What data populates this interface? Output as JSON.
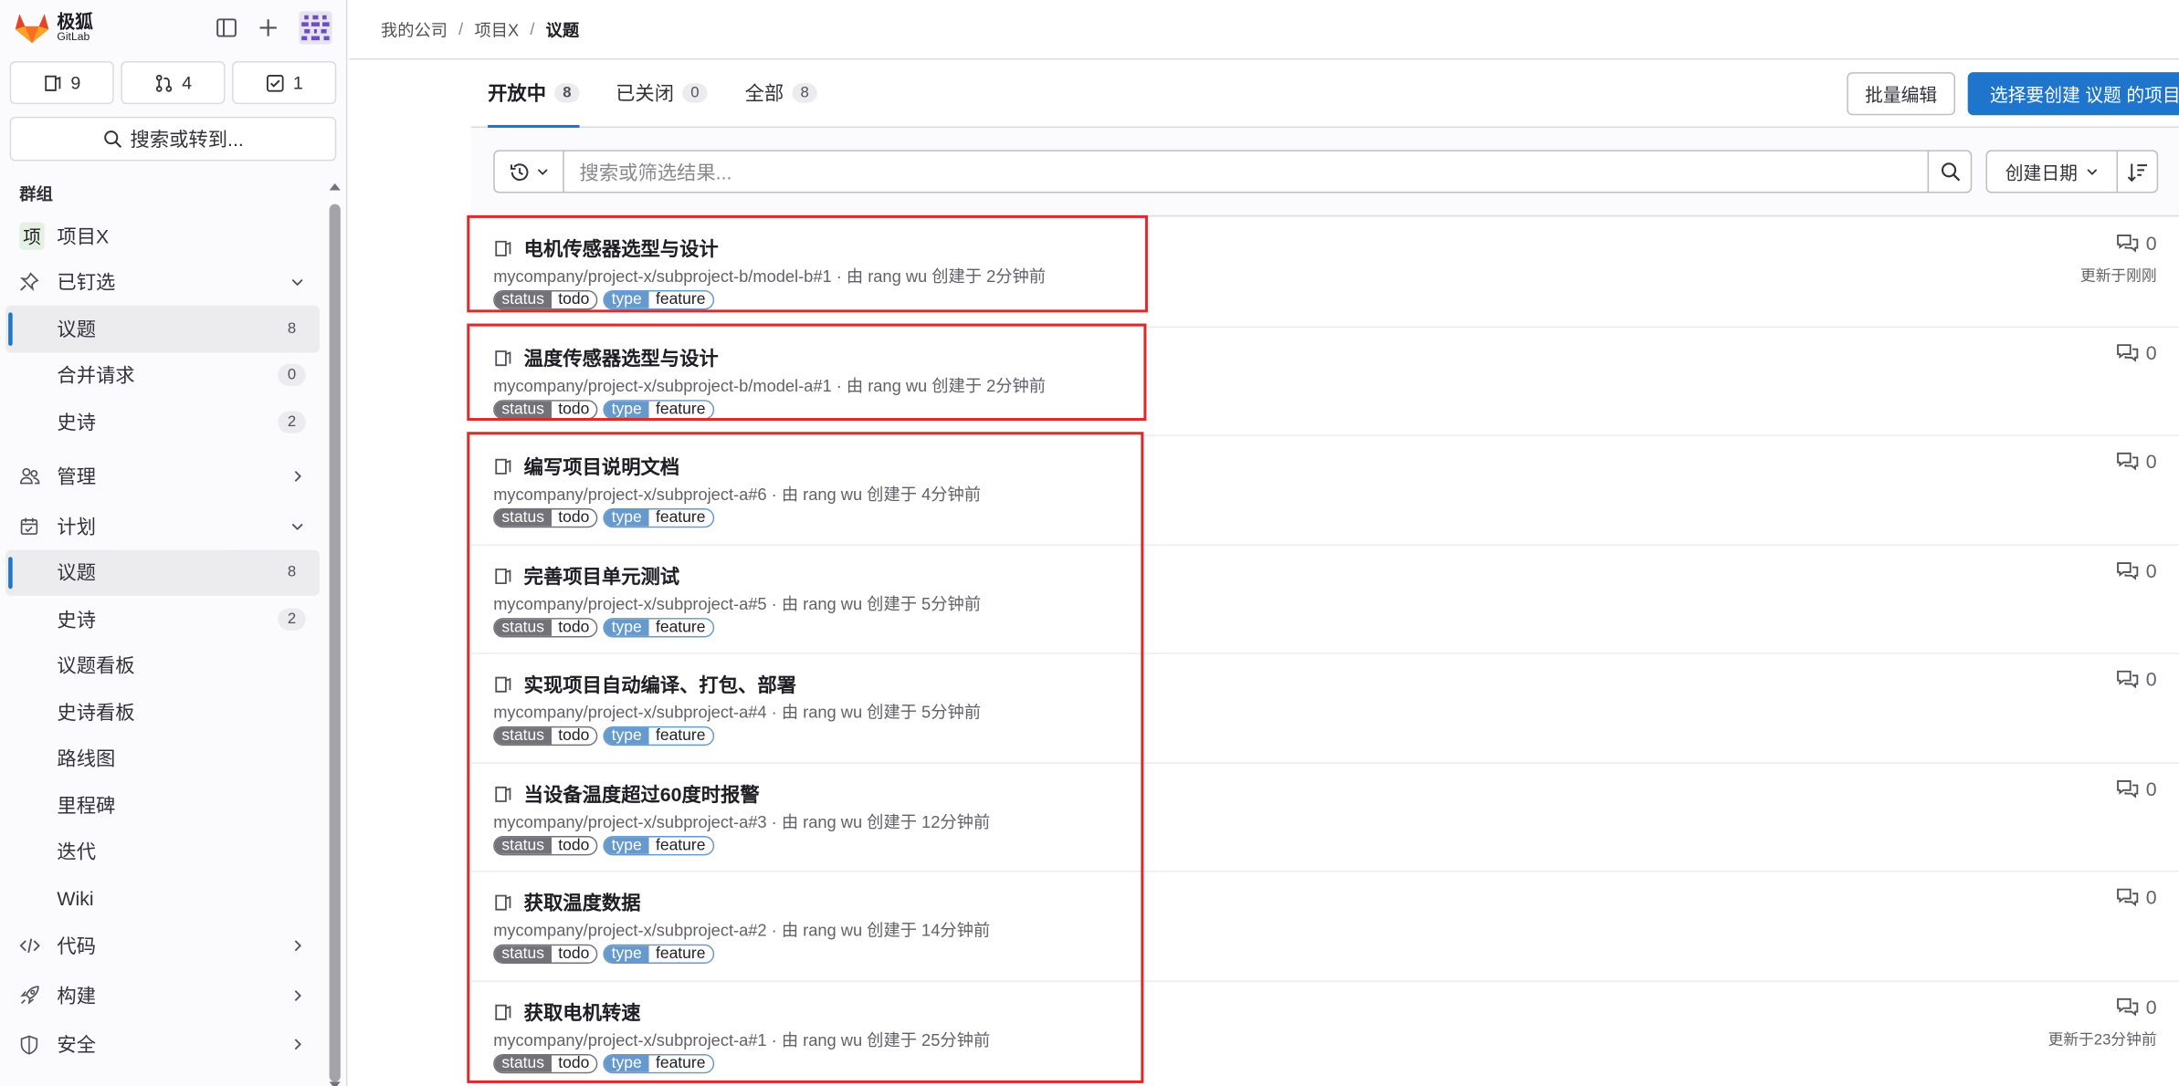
{
  "brand": {
    "name": "极狐",
    "sub": "GitLab"
  },
  "counters": {
    "issues": "9",
    "merge_requests": "4",
    "todos": "1"
  },
  "search": {
    "label": "搜索或转到..."
  },
  "sidebar": {
    "group_label": "群组",
    "project": {
      "badge": "项",
      "name": "项目X"
    },
    "pinned": {
      "label": "已钉选",
      "items": [
        {
          "label": "议题",
          "count": "8"
        },
        {
          "label": "合并请求",
          "count": "0"
        },
        {
          "label": "史诗",
          "count": "2"
        }
      ]
    },
    "manage": {
      "label": "管理"
    },
    "plan": {
      "label": "计划",
      "items": [
        {
          "label": "议题",
          "count": "8"
        },
        {
          "label": "史诗",
          "count": "2"
        },
        {
          "label": "议题看板"
        },
        {
          "label": "史诗看板"
        },
        {
          "label": "路线图"
        },
        {
          "label": "里程碑"
        },
        {
          "label": "迭代"
        },
        {
          "label": "Wiki"
        }
      ]
    },
    "code": {
      "label": "代码"
    },
    "build": {
      "label": "构建"
    },
    "security": {
      "label": "安全"
    }
  },
  "breadcrumb": [
    "我的公司",
    "项目X",
    "议题"
  ],
  "tabs": [
    {
      "label": "开放中",
      "count": "8"
    },
    {
      "label": "已关闭",
      "count": "0"
    },
    {
      "label": "全部",
      "count": "8"
    }
  ],
  "actions": {
    "bulk_edit": "批量编辑",
    "create": "选择要创建 议题 的项目"
  },
  "filter": {
    "placeholder": "搜索或筛选结果...",
    "sort": "创建日期"
  },
  "colors": {
    "accent": "#1f75cb",
    "status_label": "#737278",
    "type_label": "#6699cc",
    "highlight": "#dd2b2b"
  },
  "issues": [
    {
      "title": "电机传感器选型与设计",
      "meta": "mycompany/project-x/subproject-b/model-b#1 · 由 rang wu 创建于 2分钟前",
      "status": "todo",
      "type": "feature",
      "comments": "0",
      "updated": "更新于刚刚"
    },
    {
      "title": "温度传感器选型与设计",
      "meta": "mycompany/project-x/subproject-b/model-a#1 · 由 rang wu 创建于 2分钟前",
      "status": "todo",
      "type": "feature",
      "comments": "0",
      "updated": ""
    },
    {
      "title": "编写项目说明文档",
      "meta": "mycompany/project-x/subproject-a#6 · 由 rang wu 创建于 4分钟前",
      "status": "todo",
      "type": "feature",
      "comments": "0",
      "updated": ""
    },
    {
      "title": "完善项目单元测试",
      "meta": "mycompany/project-x/subproject-a#5 · 由 rang wu 创建于 5分钟前",
      "status": "todo",
      "type": "feature",
      "comments": "0",
      "updated": ""
    },
    {
      "title": "实现项目自动编译、打包、部署",
      "meta": "mycompany/project-x/subproject-a#4 · 由 rang wu 创建于 5分钟前",
      "status": "todo",
      "type": "feature",
      "comments": "0",
      "updated": ""
    },
    {
      "title": "当设备温度超过60度时报警",
      "meta": "mycompany/project-x/subproject-a#3 · 由 rang wu 创建于 12分钟前",
      "status": "todo",
      "type": "feature",
      "comments": "0",
      "updated": ""
    },
    {
      "title": "获取温度数据",
      "meta": "mycompany/project-x/subproject-a#2 · 由 rang wu 创建于 14分钟前",
      "status": "todo",
      "type": "feature",
      "comments": "0",
      "updated": ""
    },
    {
      "title": "获取电机转速",
      "meta": "mycompany/project-x/subproject-a#1 · 由 rang wu 创建于 25分钟前",
      "status": "todo",
      "type": "feature",
      "comments": "0",
      "updated": "更新于23分钟前"
    }
  ],
  "label_keys": {
    "status": "status",
    "type": "type"
  }
}
